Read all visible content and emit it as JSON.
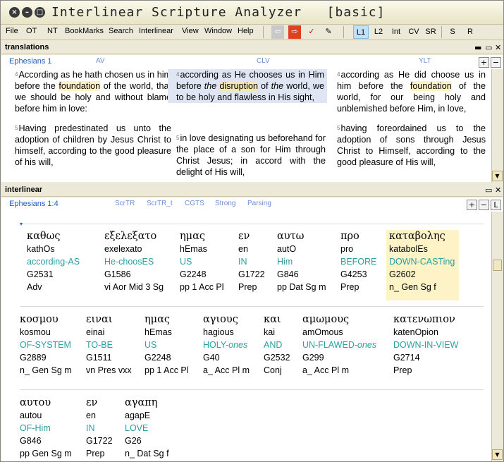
{
  "window": {
    "title": "Interlinear Scripture Analyzer",
    "mode": "[basic]"
  },
  "menu": [
    "File",
    "OT",
    "NT",
    "BookMarks",
    "Search",
    "Interlinear",
    "View",
    "Window",
    "Help"
  ],
  "toolbar": [
    "L1",
    "L2",
    "Int",
    "CV",
    "SR",
    "S",
    "R"
  ],
  "translations": {
    "title": "translations",
    "ref": "Ephesians 1",
    "versions": [
      "AV",
      "CLV",
      "YLT"
    ],
    "av": {
      "v4_a": "According as he hath chosen us in him before the ",
      "v4_hl": "foundation",
      "v4_b": " of the world, that we should be holy and without blame before him in love:",
      "v5": "Having predestinated us unto the adoption of children by Jesus Christ to himself, according to the good pleasure of his will,"
    },
    "clv": {
      "v4_a": "according as He chooses us in Him before ",
      "v4_the": "the",
      "v4_hl": "disruption",
      "v4_b": " of ",
      "v4_the2": "the",
      "v4_c": " world, we to be holy and flawless in His sight,",
      "v5": "in love designating us beforehand for the place of a son for Him through Christ Jesus; in accord with the delight of His will,"
    },
    "ylt": {
      "v4_a": "according as He did choose us in him before the ",
      "v4_hl": "foundation",
      "v4_b": " of the world, for our being holy and unblemished before Him, in love,",
      "v5": "having foreordained us to the adoption of sons through Jesus Christ to Himself, according to the good pleasure of His will,"
    },
    "verse_numbers": [
      "4",
      "5"
    ]
  },
  "interlinear": {
    "title": "interlinear",
    "ref": "Ephesians 1:4",
    "tabs": [
      "ScrTR",
      "ScrTR_t",
      "CGTS",
      "Strong",
      "Parsing"
    ],
    "rows": [
      [
        {
          "g": "καθως",
          "t": "kathOs",
          "e": "according-AS",
          "s": "G2531",
          "p": "Adv"
        },
        {
          "g": "εξελεξατο",
          "t": "exelexato",
          "e": "He-choosES",
          "s": "G1586",
          "p": "vi Aor Mid 3 Sg"
        },
        {
          "g": "ημας",
          "t": "hEmas",
          "e": "US",
          "s": "G2248",
          "p": "pp 1 Acc Pl"
        },
        {
          "g": "εν",
          "t": "en",
          "e": "IN",
          "s": "G1722",
          "p": "Prep"
        },
        {
          "g": "αυτω",
          "t": "autO",
          "e": "Him",
          "s": "G846",
          "p": "pp Dat Sg m"
        },
        {
          "g": "προ",
          "t": "pro",
          "e": "BEFORE",
          "s": "G4253",
          "p": "Prep"
        },
        {
          "g": "καταβολης",
          "t": "katabolEs",
          "e": "DOWN-CASTing",
          "s": "G2602",
          "p": "n_ Gen Sg f"
        }
      ],
      [
        {
          "g": "κοσμου",
          "t": "kosmou",
          "e": "OF-SYSTEM",
          "s": "G2889",
          "p": "n_ Gen Sg m"
        },
        {
          "g": "ειναι",
          "t": "einai",
          "e": "TO-BE",
          "s": "G1511",
          "p": "vn Pres vxx"
        },
        {
          "g": "ημας",
          "t": "hEmas",
          "e": "US",
          "s": "G2248",
          "p": "pp 1 Acc Pl"
        },
        {
          "g": "αγιους",
          "t": "hagious",
          "e": "HOLY-ones",
          "s": "G40",
          "p": "a_ Acc Pl m"
        },
        {
          "g": "και",
          "t": "kai",
          "e": "AND",
          "s": "G2532",
          "p": "Conj"
        },
        {
          "g": "αμωμους",
          "t": "amOmous",
          "e": "UN-FLAWED-ones",
          "s": "G299",
          "p": "a_ Acc Pl m"
        },
        {
          "g": "κατενωπιον",
          "t": "katenOpion",
          "e": "DOWN-IN-VIEW",
          "s": "G2714",
          "p": "Prep"
        }
      ],
      [
        {
          "g": "αυτου",
          "t": "autou",
          "e": "OF-Him",
          "s": "G846",
          "p": "pp Gen Sg m"
        },
        {
          "g": "εν",
          "t": "en",
          "e": "IN",
          "s": "G1722",
          "p": "Prep"
        },
        {
          "g": "αγαπη",
          "t": "agapE",
          "e": "LOVE",
          "s": "G26",
          "p": "n_ Dat Sg f"
        }
      ]
    ]
  }
}
